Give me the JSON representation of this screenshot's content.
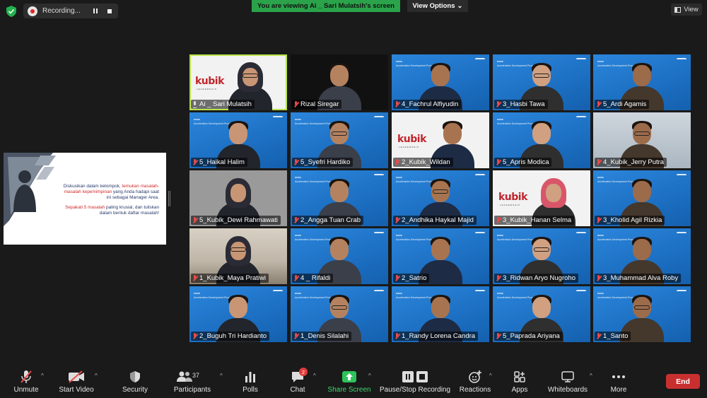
{
  "topbar": {
    "recording_label": "Recording...",
    "viewing_banner": "You are viewing Ai _ Sari Mulatsih's screen",
    "view_options": "View Options",
    "view_label": "View"
  },
  "shared_slide": {
    "line1_black": "Diskusikan dalam kelompok, ",
    "line1_red": "temukan masalah-masalah kepemimpinan",
    "line1_rest": " yang Anda hadapi saat ini sebagai Manager Area.",
    "line2_red": "Sepakati 5 masalah",
    "line2_rest": " paling krusial, dan tuliskan dalam bentuk daftar masalah!"
  },
  "tile_texts": {
    "program_title": "Acceleration Development Program",
    "brand": "aruna",
    "kubik": "kubik",
    "kubik_sub": "LEADERSHIP"
  },
  "participants": [
    {
      "name": "Ai _ Sari Mulatsih",
      "mic": "on",
      "bg": "white",
      "kind": "hijab",
      "active": true
    },
    {
      "name": "Rizal Siregar",
      "mic": "off",
      "bg": "black",
      "kind": "man"
    },
    {
      "name": "4_Fachrul Alfiyudin",
      "mic": "off",
      "bg": "blue",
      "kind": "man"
    },
    {
      "name": "3_Hasbi Tawa",
      "mic": "off",
      "bg": "blue",
      "kind": "man"
    },
    {
      "name": "5_Ardi Agamis",
      "mic": "off",
      "bg": "blue",
      "kind": "man"
    },
    {
      "name": "5_Haikal Halim",
      "mic": "off",
      "bg": "blue",
      "kind": "man"
    },
    {
      "name": "5_Syefri Hardiko",
      "mic": "off",
      "bg": "blue",
      "kind": "man"
    },
    {
      "name": "2_Kubik_Wildan",
      "mic": "off",
      "bg": "white",
      "kind": "man"
    },
    {
      "name": "5_Apris Modica",
      "mic": "off",
      "bg": "blue",
      "kind": "man"
    },
    {
      "name": "4_Kubik_Jerry Putra",
      "mic": "off",
      "bg": "photo",
      "kind": "man"
    },
    {
      "name": "5_Kubik_Dewi Rahmawati",
      "mic": "off",
      "bg": "gray",
      "kind": "hijab"
    },
    {
      "name": "2_Angga Tuan Crab",
      "mic": "off",
      "bg": "blue",
      "kind": "man"
    },
    {
      "name": "2_Andhika Haykal Majid",
      "mic": "off",
      "bg": "blue",
      "kind": "man"
    },
    {
      "name": "3_Kubik_Hanan Selma",
      "mic": "off",
      "bg": "white",
      "kind": "hijab"
    },
    {
      "name": "3_Kholid Agil Rizkia",
      "mic": "off",
      "bg": "blue",
      "kind": "man"
    },
    {
      "name": "1_Kubik_Maya Pratiwi",
      "mic": "off",
      "bg": "room",
      "kind": "hijab"
    },
    {
      "name": "4 _ Rifaldi",
      "mic": "off",
      "bg": "blue",
      "kind": "man"
    },
    {
      "name": "2_Satrio",
      "mic": "off",
      "bg": "blue",
      "kind": "man"
    },
    {
      "name": "3_Ridwan Aryo Nugroho",
      "mic": "off",
      "bg": "blue",
      "kind": "man"
    },
    {
      "name": "3_Muhammad Alva Roby",
      "mic": "off",
      "bg": "blue",
      "kind": "man"
    },
    {
      "name": "2_Buguh Tri Hardianto",
      "mic": "off",
      "bg": "blue",
      "kind": "man"
    },
    {
      "name": "1_Denis Silalahi",
      "mic": "off",
      "bg": "blue",
      "kind": "man"
    },
    {
      "name": "1_Randy Lorena Candra",
      "mic": "off",
      "bg": "blue",
      "kind": "man"
    },
    {
      "name": "5_Paprada Ariyana",
      "mic": "off",
      "bg": "blue",
      "kind": "man"
    },
    {
      "name": "1_Santo",
      "mic": "off",
      "bg": "blue",
      "kind": "man"
    }
  ],
  "toolbar": {
    "unmute": "Unmute",
    "start_video": "Start Video",
    "security": "Security",
    "participants": "Participants",
    "participants_count": "37",
    "polls": "Polls",
    "chat": "Chat",
    "chat_badge": "2",
    "share_screen": "Share Screen",
    "pause_stop": "Pause/Stop Recording",
    "reactions": "Reactions",
    "apps": "Apps",
    "whiteboards": "Whiteboards",
    "more": "More",
    "end": "End"
  },
  "colors": {
    "banner_green": "#2aa34a",
    "tile_blue": "#1e70c2",
    "active_outline": "#b9e34a",
    "end_red": "#c8302f",
    "mic_off_red": "#e84a4a"
  }
}
